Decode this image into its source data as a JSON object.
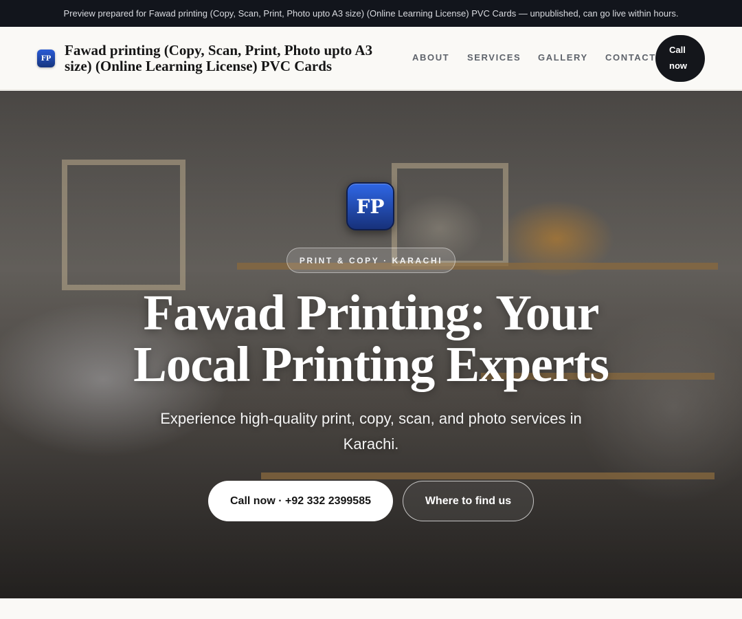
{
  "preview_banner": "Preview prepared for Fawad printing (Copy, Scan, Print, Photo upto A3 size) (Online Learning License) PVC Cards — unpublished, can go live within hours.",
  "header": {
    "logo_initials": "FP",
    "title": "Fawad printing (Copy, Scan, Print, Photo upto A3 size) (Online Learning License) PVC Cards",
    "nav": [
      "ABOUT",
      "SERVICES",
      "GALLERY",
      "CONTACT"
    ],
    "call_label_line1": "Call",
    "call_label_line2": "now"
  },
  "hero": {
    "logo_initials": "FP",
    "eyebrow": "PRINT & COPY · KARACHI",
    "title": "Fawad Printing: Your Local Printing Experts",
    "subtitle": "Experience high-quality print, copy, scan, and photo services in Karachi.",
    "primary_cta": "Call now · +92 332 2399585",
    "secondary_cta": "Where to find us"
  },
  "colors": {
    "banner_bg": "#12151c",
    "header_bg": "#faf9f6",
    "accent_blue": "#2a5bd6",
    "dark_button": "#14161b"
  }
}
